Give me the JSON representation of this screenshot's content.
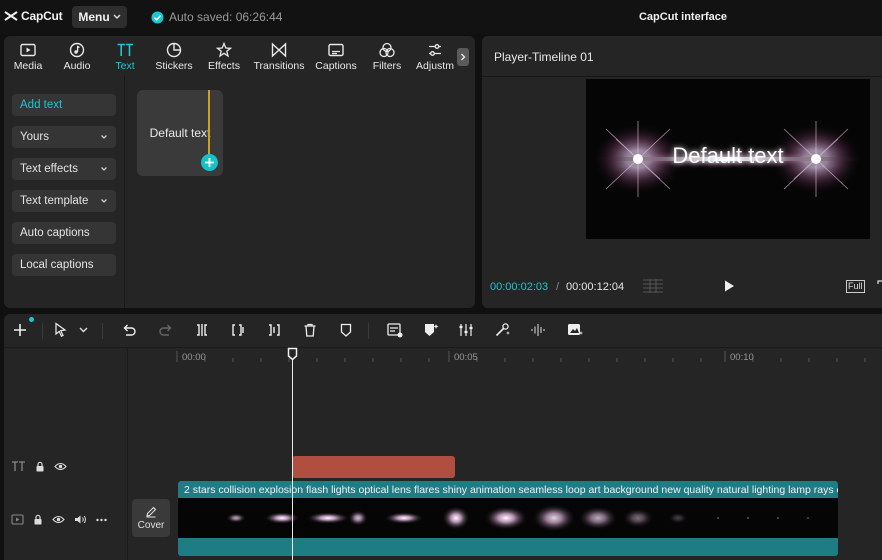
{
  "topbar": {
    "logo_text": "CapCut",
    "menu_label": "Menu",
    "autosave_text": "Auto saved: 06:26:44",
    "title": "CapCut interface",
    "accent_color": "#19c8d2"
  },
  "tabs": [
    {
      "label": "Media",
      "icon": "media-icon"
    },
    {
      "label": "Audio",
      "icon": "audio-icon"
    },
    {
      "label": "Text",
      "icon": "text-icon",
      "active": true
    },
    {
      "label": "Stickers",
      "icon": "stickers-icon"
    },
    {
      "label": "Effects",
      "icon": "effects-icon"
    },
    {
      "label": "Transitions",
      "icon": "transitions-icon"
    },
    {
      "label": "Captions",
      "icon": "captions-icon"
    },
    {
      "label": "Filters",
      "icon": "filters-icon"
    },
    {
      "label": "Adjustm",
      "icon": "adjust-icon"
    }
  ],
  "sidebar": {
    "items": [
      {
        "label": "Add text",
        "active": true
      },
      {
        "label": "Yours",
        "chevron": true
      },
      {
        "label": "Text effects",
        "chevron": true
      },
      {
        "label": "Text template",
        "chevron": true
      },
      {
        "label": "Auto captions"
      },
      {
        "label": "Local captions"
      }
    ]
  },
  "text_card": {
    "label": "Default text"
  },
  "player": {
    "title": "Player-Timeline 01",
    "preview_text": "Default text",
    "time_current": "00:00:02:03",
    "time_separator": "/",
    "time_total": "00:00:12:04",
    "full_label": "Full"
  },
  "timeline": {
    "ruler": [
      "00:00",
      "00:05",
      "00:10"
    ],
    "video_clip_label": "2 stars collision explosion flash lights optical lens flares shiny animation seamless loop art background new quality natural lighting lamp rays effect",
    "cover_label": "Cover",
    "text_clip_color": "#b04e3f",
    "video_clip_color": "#1e7d84"
  }
}
